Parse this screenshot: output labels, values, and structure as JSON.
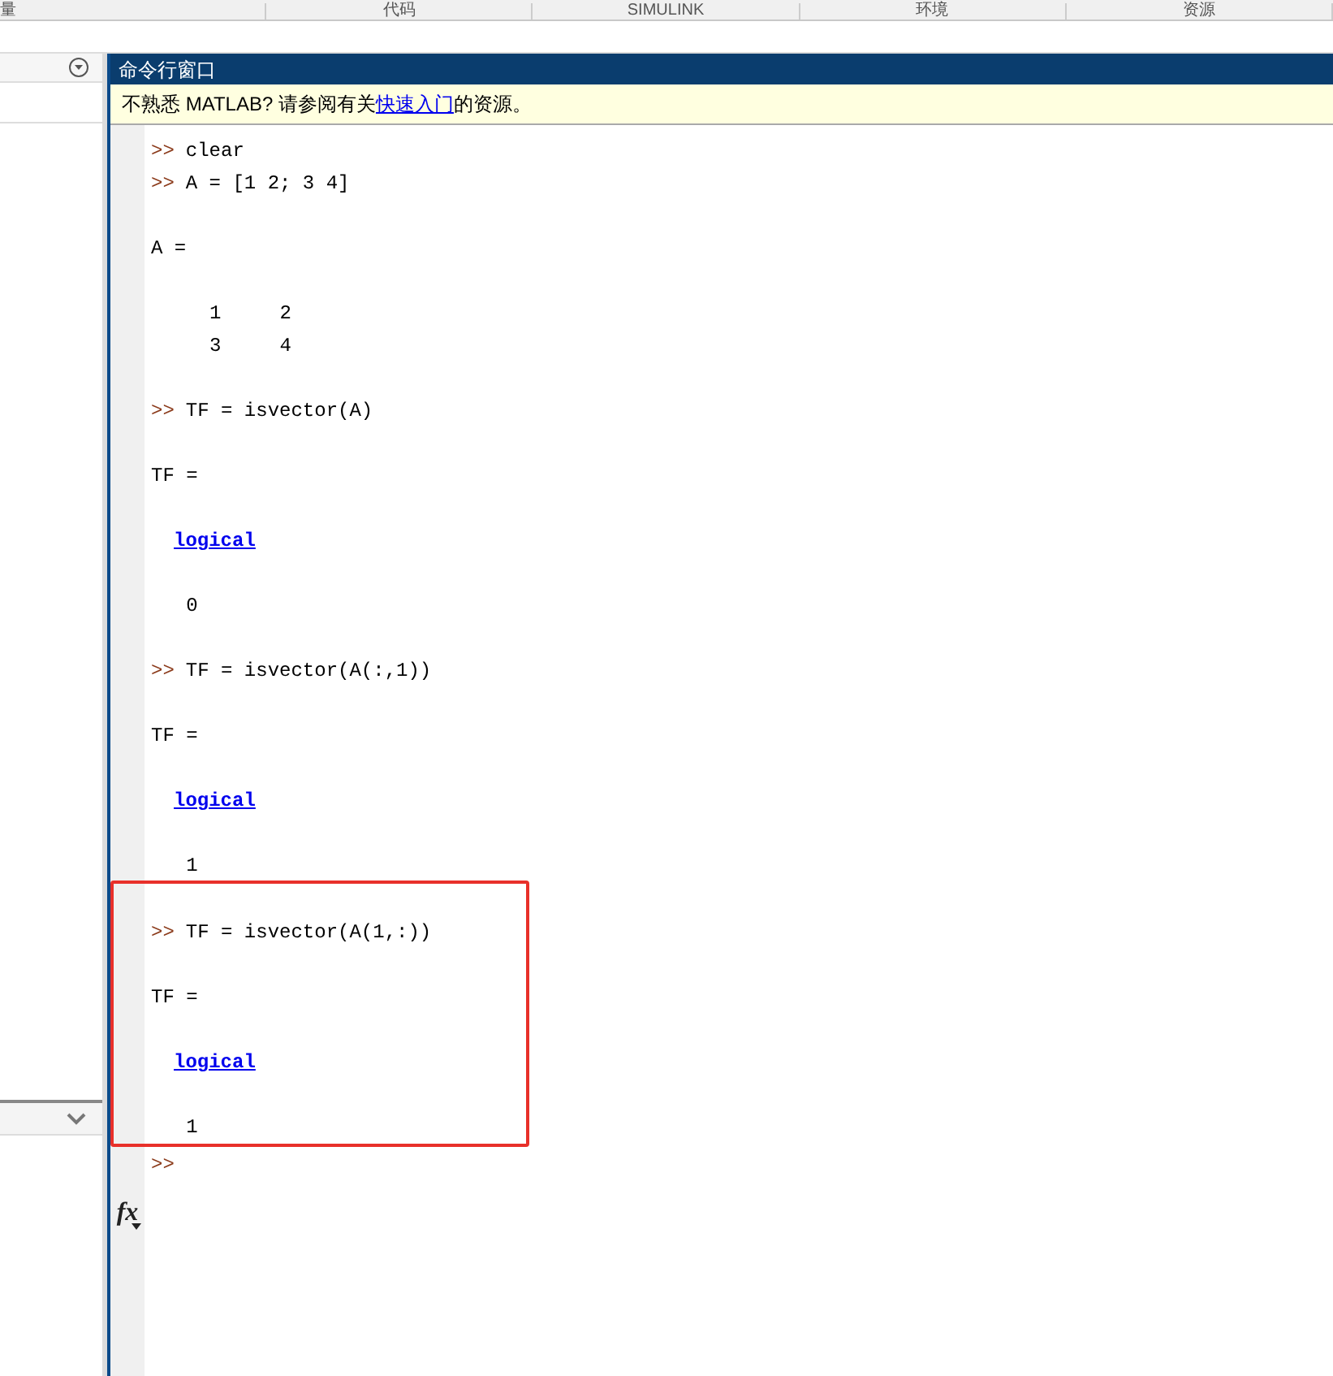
{
  "toolstrip_tabs": [
    {
      "label": "量"
    },
    {
      "label": "代码"
    },
    {
      "label": "SIMULINK"
    },
    {
      "label": "环境"
    },
    {
      "label": "资源"
    }
  ],
  "command_window": {
    "title": "命令行窗口",
    "notice": {
      "before": "不熟悉 MATLAB? 请参阅有关",
      "link": "快速入门",
      "after": "的资源。"
    },
    "sections": [
      {
        "highlighted": false,
        "lines": [
          {
            "kind": "command",
            "prompt": ">>",
            "text": "clear"
          },
          {
            "kind": "command",
            "prompt": ">>",
            "text": "A = [1 2; 3 4]"
          },
          {
            "kind": "blank"
          },
          {
            "kind": "output",
            "text": "A ="
          },
          {
            "kind": "blank"
          },
          {
            "kind": "output",
            "text": "     1     2"
          },
          {
            "kind": "output",
            "text": "     3     4"
          },
          {
            "kind": "blank"
          },
          {
            "kind": "command",
            "prompt": ">>",
            "text": "TF = isvector(A)"
          },
          {
            "kind": "blank"
          },
          {
            "kind": "output",
            "text": "TF ="
          },
          {
            "kind": "blank"
          },
          {
            "kind": "link",
            "text": "logical"
          },
          {
            "kind": "blank"
          },
          {
            "kind": "output",
            "text": "   0"
          },
          {
            "kind": "blank"
          },
          {
            "kind": "command",
            "prompt": ">>",
            "text": "TF = isvector(A(:,1))"
          },
          {
            "kind": "blank"
          },
          {
            "kind": "output",
            "text": "TF ="
          },
          {
            "kind": "blank"
          },
          {
            "kind": "link",
            "text": "logical"
          },
          {
            "kind": "blank"
          },
          {
            "kind": "output",
            "text": "   1"
          }
        ]
      },
      {
        "highlighted": true,
        "lines": [
          {
            "kind": "blank"
          },
          {
            "kind": "command",
            "prompt": ">>",
            "text": "TF = isvector(A(1,:))"
          },
          {
            "kind": "blank"
          },
          {
            "kind": "output",
            "text": "TF ="
          },
          {
            "kind": "blank"
          },
          {
            "kind": "link",
            "text": "logical"
          },
          {
            "kind": "blank"
          },
          {
            "kind": "output",
            "text": "   1"
          }
        ]
      }
    ],
    "function_button": "fx",
    "input_prompt": ">>"
  }
}
